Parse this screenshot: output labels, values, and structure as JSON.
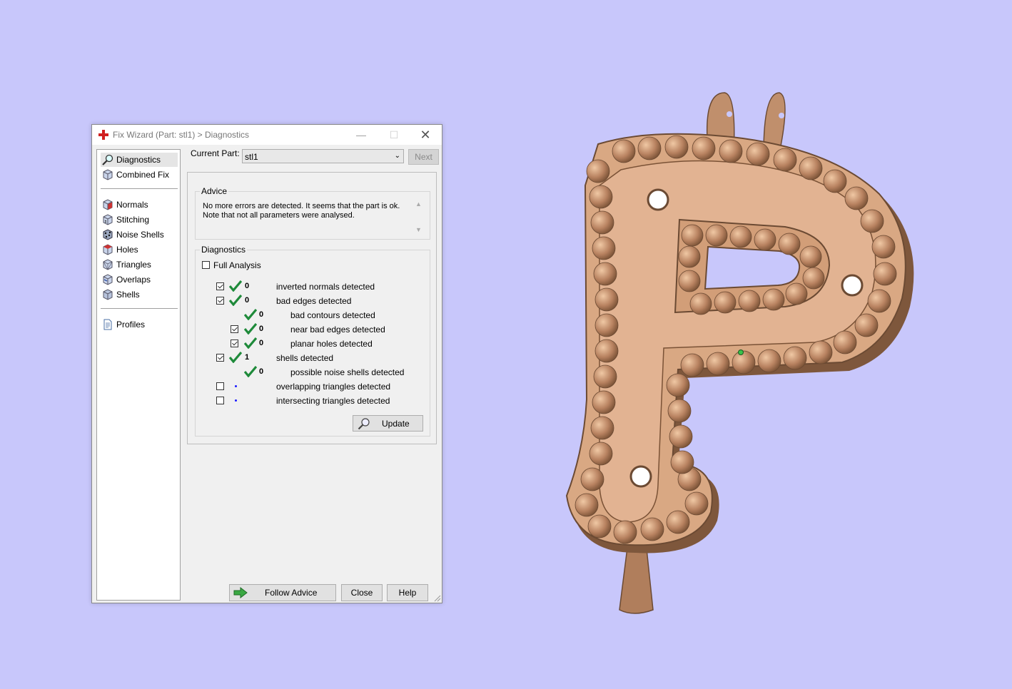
{
  "window": {
    "title": "Fix Wizard (Part: stl1) > Diagnostics",
    "controls": {
      "minimize": "—",
      "maximize": "☐",
      "close": "✕"
    }
  },
  "sidebar": {
    "items": [
      {
        "label": "Diagnostics",
        "icon": "magnifier-icon",
        "selected": true
      },
      {
        "label": "Combined Fix",
        "icon": "cube-icon"
      },
      {
        "label": "Normals",
        "icon": "normals-cube-icon"
      },
      {
        "label": "Stitching",
        "icon": "stitching-cube-icon"
      },
      {
        "label": "Noise Shells",
        "icon": "noise-shells-icon"
      },
      {
        "label": "Holes",
        "icon": "holes-cube-icon"
      },
      {
        "label": "Triangles",
        "icon": "triangles-cube-icon"
      },
      {
        "label": "Overlaps",
        "icon": "overlaps-cube-icon"
      },
      {
        "label": "Shells",
        "icon": "shells-cube-icon"
      },
      {
        "label": "Profiles",
        "icon": "document-icon"
      }
    ]
  },
  "current_part": {
    "label": "Current Part:",
    "value": "stl1"
  },
  "next_label": "Next",
  "advice": {
    "title": "Advice",
    "text_line1": "No more errors are detected. It seems that the part is ok.",
    "text_line2": "Note that not all parameters were analysed."
  },
  "diagnostics": {
    "title": "Diagnostics",
    "full_analysis_label": "Full Analysis",
    "full_analysis_checked": false,
    "rows": [
      {
        "checkbox": true,
        "checked": true,
        "status": "ok",
        "value": "0",
        "label": "inverted normals detected",
        "indent": 0
      },
      {
        "checkbox": true,
        "checked": true,
        "status": "ok",
        "value": "0",
        "label": "bad edges detected",
        "indent": 0
      },
      {
        "checkbox": false,
        "checked": false,
        "status": "ok",
        "value": "0",
        "label": "bad contours detected",
        "indent": 1
      },
      {
        "checkbox": true,
        "checked": true,
        "status": "ok",
        "value": "0",
        "label": "near bad edges detected",
        "indent": 1
      },
      {
        "checkbox": true,
        "checked": true,
        "status": "ok",
        "value": "0",
        "label": "planar holes detected",
        "indent": 1
      },
      {
        "checkbox": true,
        "checked": true,
        "status": "ok",
        "value": "1",
        "label": "shells detected",
        "indent": 0
      },
      {
        "checkbox": false,
        "checked": false,
        "status": "ok",
        "value": "0",
        "label": "possible noise shells detected",
        "indent": 1
      },
      {
        "checkbox": true,
        "checked": false,
        "status": "pending",
        "value": "",
        "label": "overlapping triangles detected",
        "indent": 0
      },
      {
        "checkbox": true,
        "checked": false,
        "status": "pending",
        "value": "",
        "label": "intersecting triangles detected",
        "indent": 0
      }
    ],
    "update_label": "Update"
  },
  "buttons": {
    "follow_advice": "Follow Advice",
    "close": "Close",
    "help": "Help"
  },
  "colors": {
    "background": "#c8c7fb",
    "model": "#d9a883",
    "check": "#1e8a3a"
  }
}
